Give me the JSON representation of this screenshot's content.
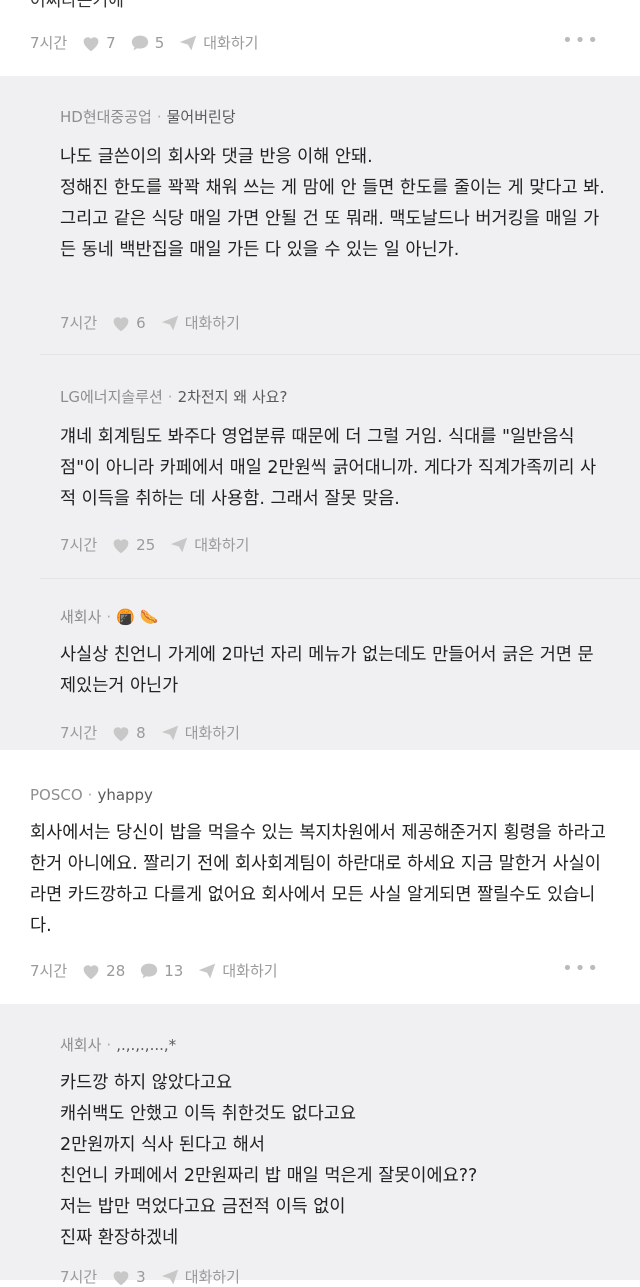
{
  "top": {
    "partial_text": "어쩌라는거에",
    "time": "7시간",
    "likes": "7",
    "comments": "5",
    "reply_label": "대화하기"
  },
  "replies1": [
    {
      "company": "HD현대중공업",
      "nickname": "물어버린당",
      "text": "나도 글쓴이의 회사와 댓글 반응 이해 안돼.\n정해진 한도를 꽉꽉 채워 쓰는 게 맘에 안 들면 한도를 줄이는 게 맞다고 봐.\n그리고 같은 식당 매일 가면 안될 건 또 뭐래. 맥도날드나 버거킹을 매일 가든 동네 백반집을 매일 가든 다 있을 수 있는 일 아닌가.",
      "time": "7시간",
      "likes": "6",
      "reply_label": "대화하기"
    },
    {
      "company": "LG에너지솔루션",
      "nickname": "2차전지 왜 사요?",
      "text": "걔네 회계팀도 봐주다 영업분류 때문에 더 그럴 거임. 식대를 \"일반음식점\"이 아니라 카페에서 매일 2만원씩 긁어대니까. 게다가 직계가족끼리 사적 이득을 취하는 데 사용함. 그래서 잘못 맞음.",
      "time": "7시간",
      "likes": "25",
      "reply_label": "대화하기"
    },
    {
      "company": "새회사",
      "nickname": "🍘 🌭",
      "text": "사실상 친언니 가게에 2마넌 자리 메뉴가 없는데도 만들어서 긁은 거면 문제있는거 아닌가",
      "time": "7시간",
      "likes": "8",
      "reply_label": "대화하기"
    }
  ],
  "comment2": {
    "company": "POSCO",
    "nickname": "yhappy",
    "text": "회사에서는 당신이 밥을 먹을수 있는 복지차원에서 제공해준거지 횡령을 하라고 한거 아니에요. 짤리기 전에 회사회계팀이 하란대로 하세요 지금 말한거 사실이라면 카드깡하고 다를게 없어요 회사에서 모든 사실 알게되면 짤릴수도 있습니다.",
    "time": "7시간",
    "likes": "28",
    "comments": "13",
    "reply_label": "대화하기"
  },
  "reply2": {
    "company": "새회사",
    "nickname": ",.,.,.,...,*",
    "text": "카드깡 하지 않았다고요\n캐쉬백도 안했고 이득 취한것도 없다고요\n2만원까지 식사 된다고 해서\n친언니 카페에서 2만원짜리 밥 매일 먹은게 잘못이에요??\n저는 밥만 먹었다고요 금전적 이득 없이\n진짜 환장하겠네",
    "time": "7시간",
    "likes": "3",
    "reply_label": "대화하기"
  },
  "icons": {
    "heart": "heart-icon",
    "comment": "comment-bubble-icon",
    "send": "paper-plane-icon",
    "more": "more-dots-icon"
  },
  "colors": {
    "reply_bg": "#f0f0f3",
    "meta_gray": "#9a9a9a",
    "text": "#222222"
  }
}
